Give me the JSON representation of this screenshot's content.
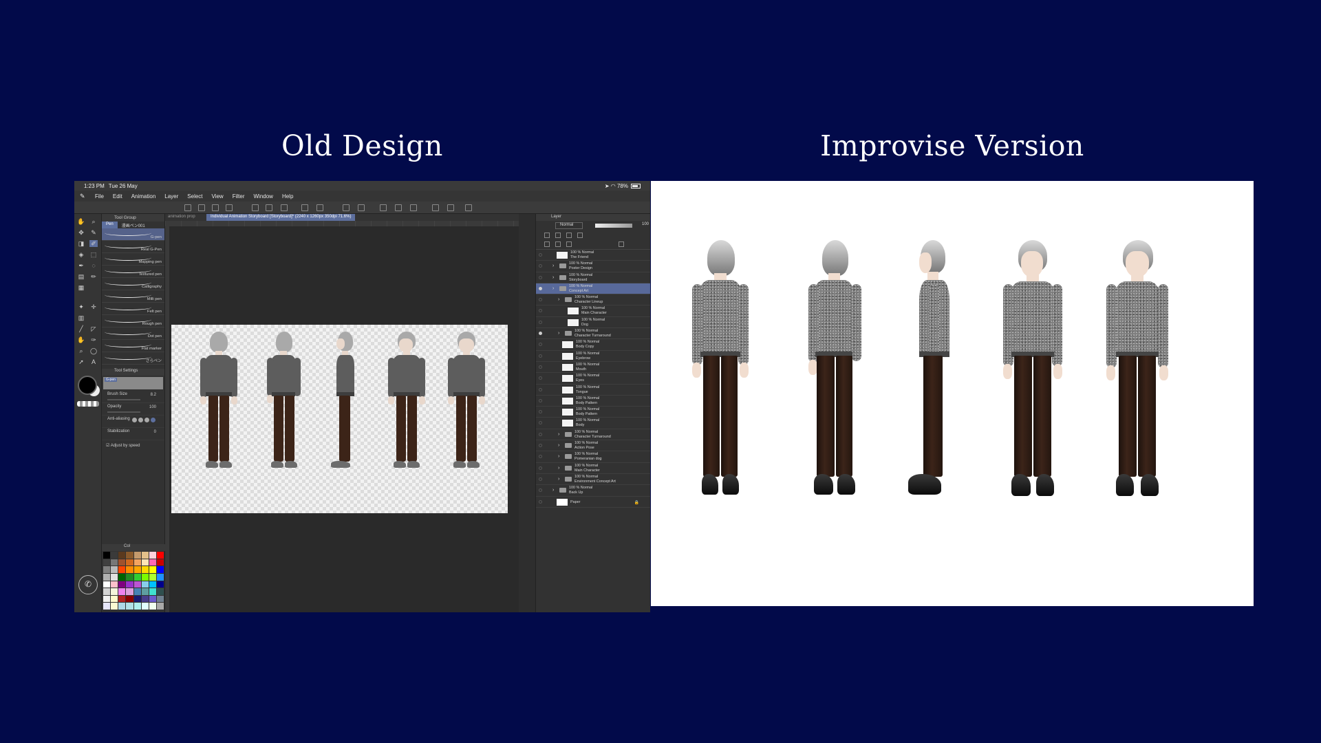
{
  "headings": {
    "left": "Old Design",
    "right": "Improvise Version"
  },
  "status": {
    "time": "1:23 PM",
    "date": "Tue 26 May",
    "battery": "78%"
  },
  "menu": [
    "File",
    "Edit",
    "Animation",
    "Layer",
    "Select",
    "View",
    "Filter",
    "Window",
    "Help"
  ],
  "subtool": {
    "group_title": "Tool Group",
    "tab_active": "Pen",
    "tab_other": "漫画ペン001",
    "brushes": [
      "G-pen",
      "Real G-Pen",
      "Mapping pen",
      "Textured pen",
      "Calligraphy",
      "Milli pen",
      "Felt pen",
      "Rough pen",
      "Dot pen",
      "Flat marker",
      "さらペン"
    ],
    "settings_title": "Tool Settings",
    "preview_label": "G-pen",
    "brush_size_label": "Brush Size",
    "brush_size_value": "8.2",
    "opacity_label": "Opacity",
    "opacity_value": "100",
    "antialias_label": "Anti-aliasing",
    "stabilization_label": "Stabilization",
    "stabilization_value": "0",
    "adjust_label": "Adjust by speed",
    "color_tab": "Col"
  },
  "document": {
    "tab_inactive": "animation prop",
    "tab_active": "Individual Animation Storyboard [Storyboard]* (2240 x 1260px 350dpi 71.6%)"
  },
  "layers": {
    "title": "Layer",
    "blend_mode": "Normal",
    "opacity": "100",
    "items": [
      {
        "pct": "100 %",
        "mode": "Normal",
        "name": "The Friend",
        "kind": "text",
        "indent": 0
      },
      {
        "pct": "100 %",
        "mode": "Normal",
        "name": "Poster Design",
        "kind": "folder",
        "indent": 0
      },
      {
        "pct": "100 %",
        "mode": "Normal",
        "name": "Storyboard",
        "kind": "folder",
        "indent": 0
      },
      {
        "pct": "100 %",
        "mode": "Normal",
        "name": "Concept Art",
        "kind": "folder",
        "indent": 0,
        "selected": true
      },
      {
        "pct": "100 %",
        "mode": "Normal",
        "name": "Character Lineup",
        "kind": "folder",
        "indent": 1
      },
      {
        "pct": "100 %",
        "mode": "Normal",
        "name": "Main Character",
        "kind": "image",
        "indent": 2
      },
      {
        "pct": "100 %",
        "mode": "Normal",
        "name": "Dog",
        "kind": "image",
        "indent": 2
      },
      {
        "pct": "100 %",
        "mode": "Normal",
        "name": "Character Turnaround",
        "kind": "folder",
        "indent": 1
      },
      {
        "pct": "100 %",
        "mode": "Normal",
        "name": "Body Copy",
        "kind": "image",
        "indent": 1
      },
      {
        "pct": "100 %",
        "mode": "Normal",
        "name": "Eyebrow",
        "kind": "image",
        "indent": 1
      },
      {
        "pct": "100 %",
        "mode": "Normal",
        "name": "Mouth",
        "kind": "image",
        "indent": 1
      },
      {
        "pct": "100 %",
        "mode": "Normal",
        "name": "Eyes",
        "kind": "image",
        "indent": 1
      },
      {
        "pct": "100 %",
        "mode": "Normal",
        "name": "Tongue",
        "kind": "image",
        "indent": 1
      },
      {
        "pct": "100 %",
        "mode": "Normal",
        "name": "Body Pattern",
        "kind": "image",
        "indent": 1
      },
      {
        "pct": "100 %",
        "mode": "Normal",
        "name": "Body Pattern",
        "kind": "image",
        "indent": 1
      },
      {
        "pct": "100 %",
        "mode": "Normal",
        "name": "Body",
        "kind": "image",
        "indent": 1
      },
      {
        "pct": "100 %",
        "mode": "Normal",
        "name": "Character Turnaround",
        "kind": "folder",
        "indent": 1
      },
      {
        "pct": "100 %",
        "mode": "Normal",
        "name": "Action Pose",
        "kind": "folder",
        "indent": 1
      },
      {
        "pct": "100 %",
        "mode": "Normal",
        "name": "Pomeranian dog",
        "kind": "folder",
        "indent": 1
      },
      {
        "pct": "100 %",
        "mode": "Normal",
        "name": "Main Character",
        "kind": "folder",
        "indent": 1
      },
      {
        "pct": "100 %",
        "mode": "Normal",
        "name": "Environment Concept Art",
        "kind": "folder",
        "indent": 1
      },
      {
        "pct": "100 %",
        "mode": "Normal",
        "name": "Back Up",
        "kind": "folder",
        "indent": 0
      },
      {
        "pct": "",
        "mode": "",
        "name": "Paper",
        "kind": "paper",
        "indent": 0
      }
    ]
  },
  "colors": {
    "background": "#020a4a",
    "accent": "#5d6f9e",
    "sweater_old": "#5d5d5d",
    "pants": "#3c2418",
    "palette": [
      "#000000",
      "#3a3a3a",
      "#5b3a1e",
      "#8a5a2b",
      "#c49a6c",
      "#e3c08a",
      "#ffd1dc",
      "#ff0000",
      "#404040",
      "#777777",
      "#a0522d",
      "#d2691e",
      "#f4a460",
      "#ffe4b5",
      "#ff69b4",
      "#cc0000",
      "#808080",
      "#bbbbbb",
      "#ff4500",
      "#ff8c00",
      "#ffa500",
      "#ffd700",
      "#ffff00",
      "#0000ff",
      "#b0b0b0",
      "#e0e0e0",
      "#006400",
      "#228b22",
      "#32cd32",
      "#7cfc00",
      "#adff2f",
      "#1e90ff",
      "#ffffff",
      "#ffc0cb",
      "#800080",
      "#9932cc",
      "#ba55d3",
      "#87ceeb",
      "#00bfff",
      "#00008b",
      "#d3d3d3",
      "#f5f5dc",
      "#ee82ee",
      "#dda0dd",
      "#4682b4",
      "#5f9ea0",
      "#40e0d0",
      "#2f4f4f",
      "#f0f0f0",
      "#fffacd",
      "#b22222",
      "#8b0000",
      "#191970",
      "#483d8b",
      "#6a5acd",
      "#708090",
      "#e6e6fa",
      "#fafad2",
      "#add8e6",
      "#b0e0e6",
      "#afeeee",
      "#e0ffff",
      "#f0fff0",
      "#a9a9a9"
    ]
  },
  "icons": {
    "app_logo": "pen-nib-icon",
    "status": [
      "location-icon",
      "wifi-icon",
      "battery-icon"
    ],
    "tools": [
      "hand-icon",
      "zoom-icon",
      "move-icon",
      "select-icon",
      "eraser-icon",
      "pen-icon",
      "brush-icon",
      "fill-icon",
      "text-icon",
      "gradient-icon",
      "ruler-icon",
      "eyedropper-icon"
    ]
  }
}
